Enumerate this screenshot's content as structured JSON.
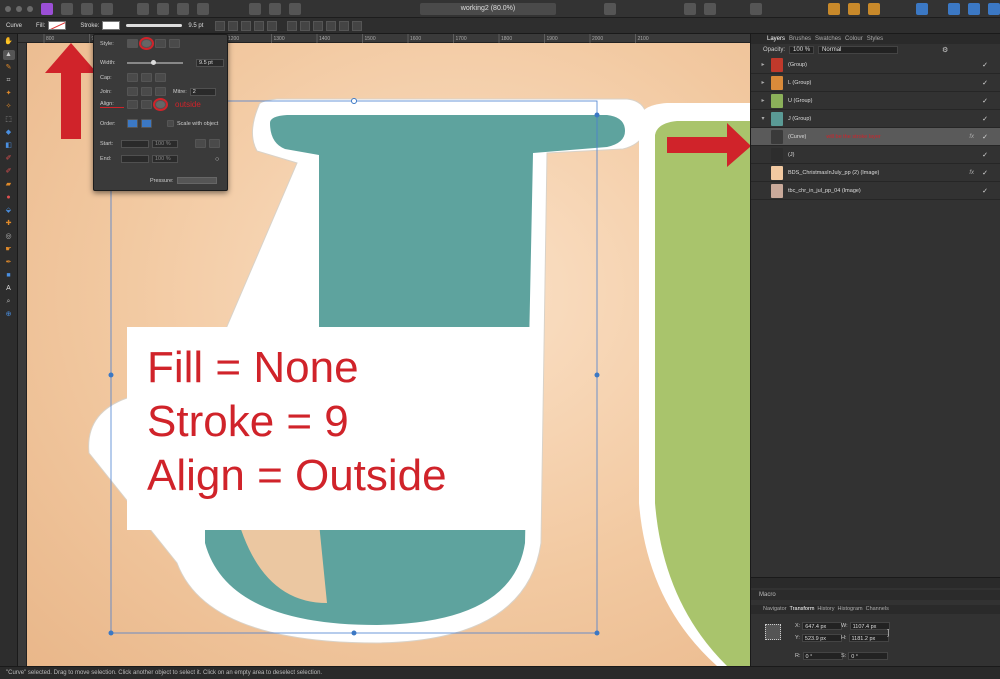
{
  "document": {
    "title": "working2 (80.0%)"
  },
  "context_toolbar": {
    "object_label": "Curve",
    "fill_label": "Fill:",
    "stroke_label": "Stroke:",
    "stroke_value": "9.5 pt"
  },
  "ruler": {
    "ticks": [
      "800",
      "900",
      "1000",
      "1100",
      "1200",
      "1300",
      "1400",
      "1500",
      "1600",
      "1700",
      "1800",
      "1900",
      "2000",
      "2100"
    ]
  },
  "stroke_popup": {
    "style_label": "Style:",
    "width_label": "Width:",
    "width_value": "9.5 pt",
    "cap_label": "Cap:",
    "join_label": "Join:",
    "mitre_label": "Mitre:",
    "mitre_value": "2",
    "align_label": "Align:",
    "align_annotation": "outside",
    "order_label": "Order:",
    "scale_label": "Scale with object",
    "start_label": "Start:",
    "end_label": "End:",
    "start_percent": "100 %",
    "end_percent": "100 %",
    "pressure_label": "Pressure:"
  },
  "annotation": {
    "line1": "Fill = None",
    "line2": "Stroke = 9",
    "line3": "Align = Outside"
  },
  "panel": {
    "tabs": [
      "Layers",
      "Brushes",
      "Swatches",
      "Colour",
      "Styles"
    ],
    "opacity_label": "Opacity:",
    "opacity_value": "100 %",
    "blend_mode": "Normal",
    "layers": [
      {
        "name": "(Group)",
        "thumb": "#c0392b",
        "tri": "▸",
        "fx": ""
      },
      {
        "name": "L (Group)",
        "thumb": "#d98a3a",
        "tri": "▸",
        "fx": ""
      },
      {
        "name": "U (Group)",
        "thumb": "#8bb05a",
        "tri": "▸",
        "fx": ""
      },
      {
        "name": "J (Group)",
        "thumb": "#5a9a95",
        "tri": "▾",
        "fx": ""
      },
      {
        "name": "(Curve)",
        "thumb": "#3a3a3a",
        "tri": "",
        "fx": "fx",
        "selected": true,
        "note": "will be the stroke layer"
      },
      {
        "name": "(J)",
        "thumb": "#2d2d2d",
        "tri": "",
        "fx": ""
      },
      {
        "name": "BDS_ChristmasInJuly_pp (2) (Image)",
        "thumb": "#f2c9a1",
        "tri": "",
        "fx": "fx"
      },
      {
        "name": "tbc_chr_in_jul_pp_04 (Image)",
        "thumb": "#c9a99a",
        "tri": "",
        "fx": ""
      }
    ],
    "macro_label": "Macro",
    "transform_tabs": [
      "Navigator",
      "Transform",
      "History",
      "Histogram",
      "Channels"
    ],
    "transform": {
      "x_label": "X:",
      "x_value": "647.4 px",
      "y_label": "Y:",
      "y_value": "523.9 px",
      "w_label": "W:",
      "w_value": "1107.4 px",
      "h_label": "H:",
      "h_value": "1181.2 px",
      "r_label": "R:",
      "r_value": "0 °",
      "s_label": "S:",
      "s_value": "0 °"
    }
  },
  "status": {
    "text": "\"Curve\" selected. Drag to move selection. Click another object to select it. Click on an empty area to deselect selection."
  },
  "colors": {
    "accent_red": "#d0232a",
    "teal": "#5ea39e",
    "green": "#a9c46c"
  }
}
